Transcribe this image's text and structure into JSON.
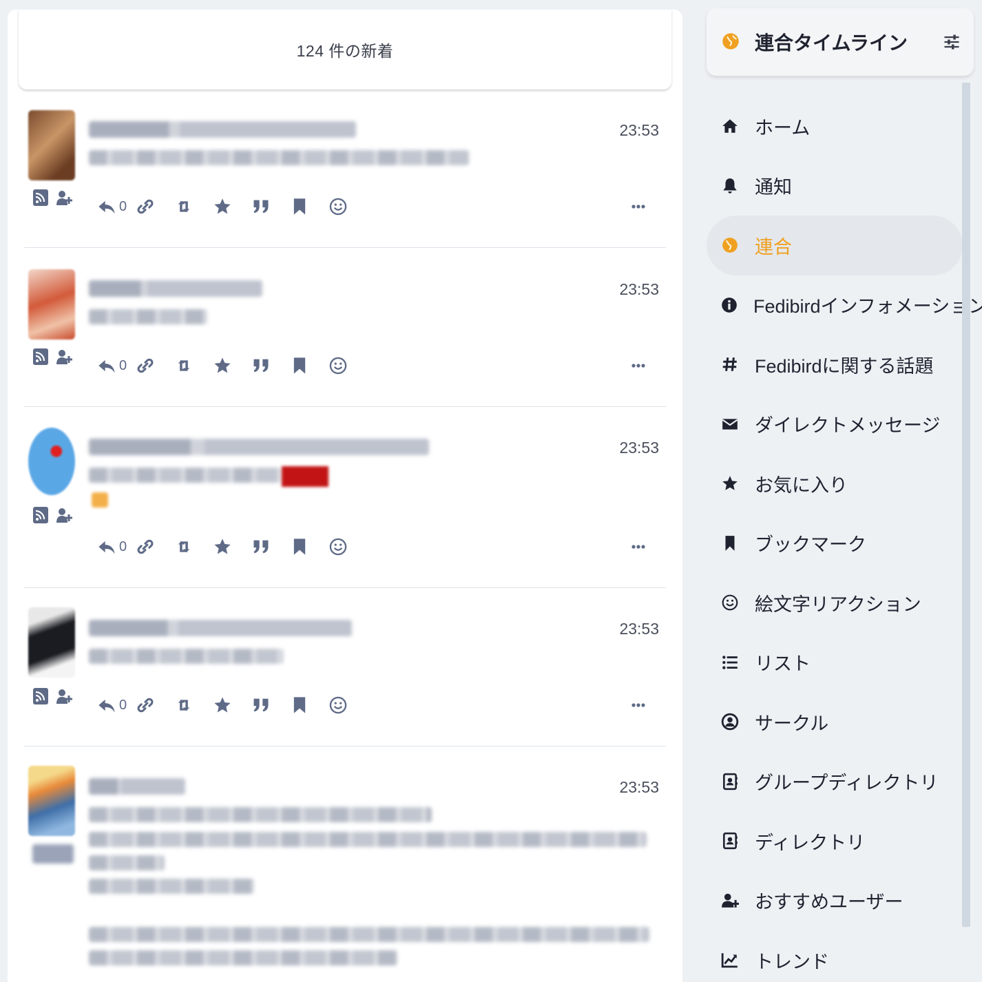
{
  "timeline": {
    "new_posts_banner": "124 件の新着",
    "statuses": [
      {
        "time": "23:53",
        "reply_count": "0"
      },
      {
        "time": "23:53",
        "reply_count": "0"
      },
      {
        "time": "23:53",
        "reply_count": "0"
      },
      {
        "time": "23:53",
        "reply_count": "0"
      },
      {
        "time": "23:53"
      }
    ]
  },
  "sidebar": {
    "header_title": "連合タイムライン",
    "items": [
      {
        "label": "ホーム",
        "icon": "home-icon"
      },
      {
        "label": "通知",
        "icon": "bell-icon"
      },
      {
        "label": "連合",
        "icon": "globe-icon",
        "active": true
      },
      {
        "label": "Fedibirdインフォメーション",
        "icon": "info-icon"
      },
      {
        "label": "Fedibirdに関する話題",
        "icon": "hashtag-icon"
      },
      {
        "label": "ダイレクトメッセージ",
        "icon": "envelope-icon"
      },
      {
        "label": "お気に入り",
        "icon": "star-icon"
      },
      {
        "label": "ブックマーク",
        "icon": "bookmark-icon"
      },
      {
        "label": "絵文字リアクション",
        "icon": "smile-icon"
      },
      {
        "label": "リスト",
        "icon": "list-icon"
      },
      {
        "label": "サークル",
        "icon": "user-circle-icon"
      },
      {
        "label": "グループディレクトリ",
        "icon": "address-book-icon"
      },
      {
        "label": "ディレクトリ",
        "icon": "address-book-icon"
      },
      {
        "label": "おすすめユーザー",
        "icon": "user-plus-icon"
      },
      {
        "label": "トレンド",
        "icon": "chart-line-icon"
      }
    ]
  },
  "colors": {
    "accent": "#f0a020",
    "icon_gray": "#5e6a86",
    "background": "#eef1f4"
  }
}
